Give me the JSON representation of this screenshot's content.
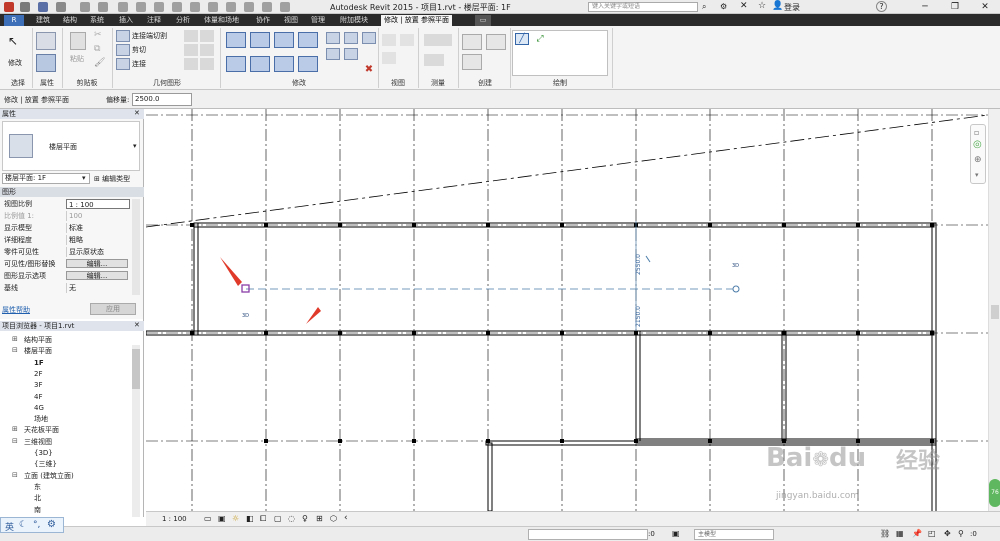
{
  "window": {
    "title": "Autodesk Revit 2015 -   项目1.rvt - 楼层平面: 1F",
    "search_placeholder": "键入关键字或短语",
    "login": "登录",
    "help": "?"
  },
  "ribbon_tabs": [
    "建筑",
    "结构",
    "系统",
    "插入",
    "注释",
    "分析",
    "体量和场地",
    "协作",
    "视图",
    "管理",
    "附加模块",
    "修改 | 放置 参照平面"
  ],
  "ribbon": {
    "modify_label": "修改",
    "paste_label": "粘贴",
    "cut_join": "连接端切割",
    "cut": "剪切",
    "join": "连接",
    "panels": [
      "选择",
      "属性",
      "剪贴板",
      "几何图形",
      "修改",
      "视图",
      "测量",
      "创建",
      "绘制"
    ]
  },
  "options_bar": {
    "context": "修改 | 放置 参照平面",
    "offset_label": "偏移量:",
    "offset_value": "2500.0"
  },
  "properties": {
    "header": "属性",
    "type_name": "楼层平面",
    "instance_filter": "楼层平面: 1F",
    "edit_type": "编辑类型",
    "section": "图形",
    "rows": [
      {
        "k": "视图比例",
        "v": "1 : 100"
      },
      {
        "k": "比例值 1:",
        "v": "100"
      },
      {
        "k": "显示模型",
        "v": "标准"
      },
      {
        "k": "详细程度",
        "v": "粗略"
      },
      {
        "k": "零件可见性",
        "v": "显示原状态"
      },
      {
        "k": "可见性/图形替换",
        "v": "编辑..."
      },
      {
        "k": "图形显示选项",
        "v": "编辑..."
      },
      {
        "k": "基线",
        "v": "无"
      }
    ],
    "help_link": "属性帮助",
    "apply": "应用"
  },
  "browser": {
    "header": "项目浏览器 - 项目1.rvt",
    "items": [
      {
        "label": "结构平面",
        "level": 1,
        "toggle": "+"
      },
      {
        "label": "楼层平面",
        "level": 1,
        "toggle": "-"
      },
      {
        "label": "1F",
        "level": 2,
        "toggle": ""
      },
      {
        "label": "2F",
        "level": 2,
        "toggle": ""
      },
      {
        "label": "3F",
        "level": 2,
        "toggle": ""
      },
      {
        "label": "4F",
        "level": 2,
        "toggle": ""
      },
      {
        "label": "4G",
        "level": 2,
        "toggle": ""
      },
      {
        "label": "场地",
        "level": 2,
        "toggle": ""
      },
      {
        "label": "天花板平面",
        "level": 1,
        "toggle": "+"
      },
      {
        "label": "三维视图",
        "level": 1,
        "toggle": "-"
      },
      {
        "label": "{3D}",
        "level": 2,
        "toggle": ""
      },
      {
        "label": "{三维}",
        "level": 2,
        "toggle": ""
      },
      {
        "label": "立面 (建筑立面)",
        "level": 1,
        "toggle": "-"
      },
      {
        "label": "东",
        "level": 2,
        "toggle": ""
      },
      {
        "label": "北",
        "level": 2,
        "toggle": ""
      },
      {
        "label": "南",
        "level": 2,
        "toggle": ""
      }
    ]
  },
  "canvas": {
    "dim_upper": "2550.0",
    "dim_lower": "2150.0",
    "tag_3d_1": "3D",
    "tag_3d_2": "3D"
  },
  "view_bar": {
    "scale": "1 : 100"
  },
  "status_bar": {
    "field_value": ":0",
    "model_label": "主模型",
    "count": ":0"
  },
  "ime": {
    "lang": "英"
  },
  "watermark": {
    "brand": "Bai",
    "brand2": "du",
    "suffix": "经验",
    "url": "jingyan.baidu.com"
  }
}
